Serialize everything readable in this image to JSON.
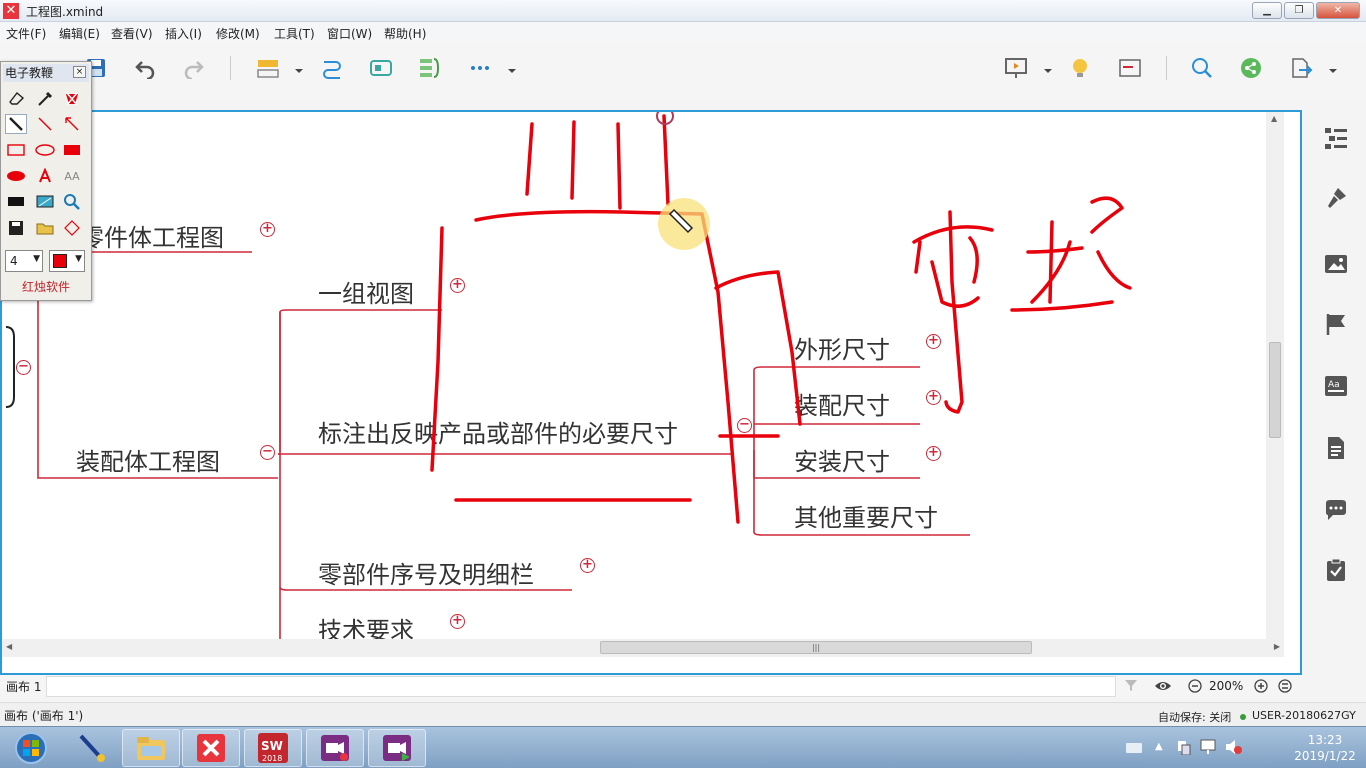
{
  "window": {
    "title": "工程图.xmind",
    "app_icon": "xmind-logo-icon"
  },
  "menu": [
    "文件(F)",
    "编辑(E)",
    "查看(V)",
    "插入(I)",
    "修改(M)",
    "工具(T)",
    "窗口(W)",
    "帮助(H)"
  ],
  "mindmap": {
    "topic_part": "零件体工程图",
    "topic_assembly": "装配体工程图",
    "children": {
      "views": "一组视图",
      "dimensions": "标注出反映产品或部件的必要尺寸",
      "bom": "零部件序号及明细栏",
      "tech": "技术要求"
    },
    "dimension_children": [
      "外形尺寸",
      "装配尺寸",
      "安装尺寸",
      "其他重要尺寸"
    ],
    "expand_symbol": "+",
    "collapse_symbol": "−"
  },
  "annotation_color": "#e8000b",
  "panel": {
    "title": "电子教鞭",
    "close": "×",
    "pen_size": "4",
    "footer": "红烛软件",
    "aa_label": "AA"
  },
  "sheetbar": {
    "tab": "画布 1",
    "zoom": "200%"
  },
  "status": {
    "sheet": "画布 ('画布 1')",
    "autosave": "自动保存: 关闭",
    "user": "USER-20180627GY"
  },
  "taskbar": {
    "time": "13:23",
    "date": "2019/1/22",
    "sw_label": "2018"
  }
}
